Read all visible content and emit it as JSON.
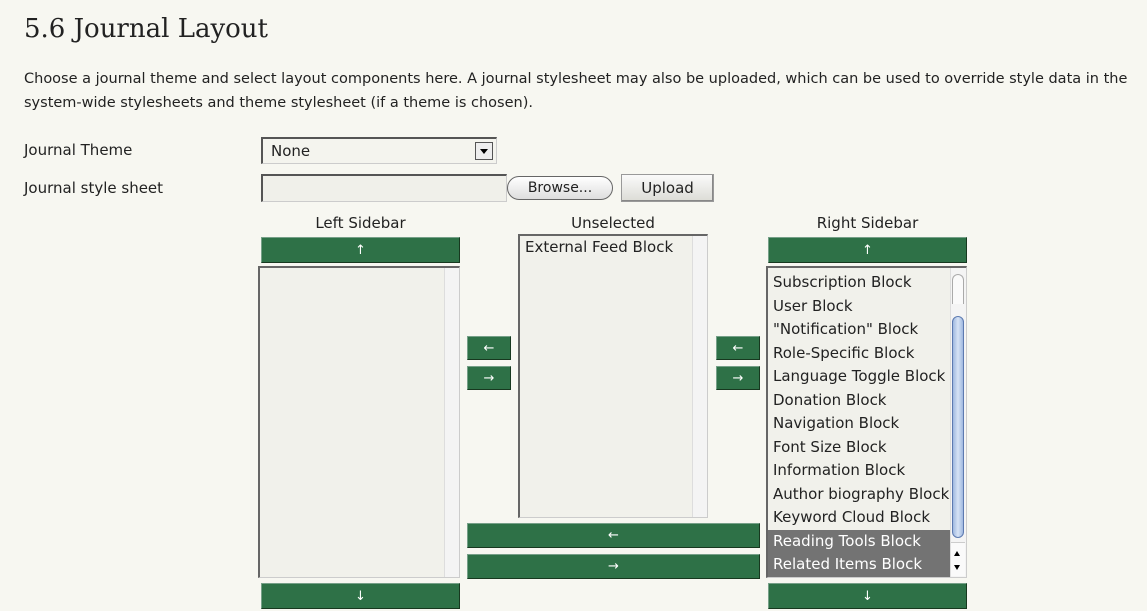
{
  "page": {
    "title": "5.6 Journal Layout",
    "description": "Choose a journal theme and select layout components here. A journal stylesheet may also be uploaded, which can be used to override style data in the system-wide stylesheets and theme stylesheet (if a theme is chosen)."
  },
  "form": {
    "theme_label": "Journal Theme",
    "theme_value": "None",
    "stylesheet_label": "Journal style sheet",
    "stylesheet_value": "",
    "browse_label": "Browse...",
    "upload_label": "Upload"
  },
  "columns": {
    "left": {
      "header": "Left Sidebar",
      "items": []
    },
    "unselected": {
      "header": "Unselected",
      "items": [
        "External Feed Block"
      ]
    },
    "right": {
      "header": "Right Sidebar",
      "items": [
        {
          "label": "Subscription Block",
          "selected": false
        },
        {
          "label": "User Block",
          "selected": false
        },
        {
          "label": "\"Notification\" Block",
          "selected": false
        },
        {
          "label": "Role-Specific Block",
          "selected": false
        },
        {
          "label": "Language Toggle Block",
          "selected": false
        },
        {
          "label": "Donation Block",
          "selected": false
        },
        {
          "label": "Navigation Block",
          "selected": false
        },
        {
          "label": "Font Size Block",
          "selected": false
        },
        {
          "label": "Information Block",
          "selected": false
        },
        {
          "label": "Author biography Block",
          "selected": false
        },
        {
          "label": "Keyword Cloud Block",
          "selected": false
        },
        {
          "label": "Reading Tools Block",
          "selected": true
        },
        {
          "label": "Related Items Block",
          "selected": true
        }
      ]
    }
  },
  "buttons": {
    "up": "↑",
    "down": "↓",
    "left": "←",
    "right": "→"
  },
  "colors": {
    "accent_green": "#2e7147",
    "background": "#f7f7f1",
    "selected_row": "#737373"
  }
}
